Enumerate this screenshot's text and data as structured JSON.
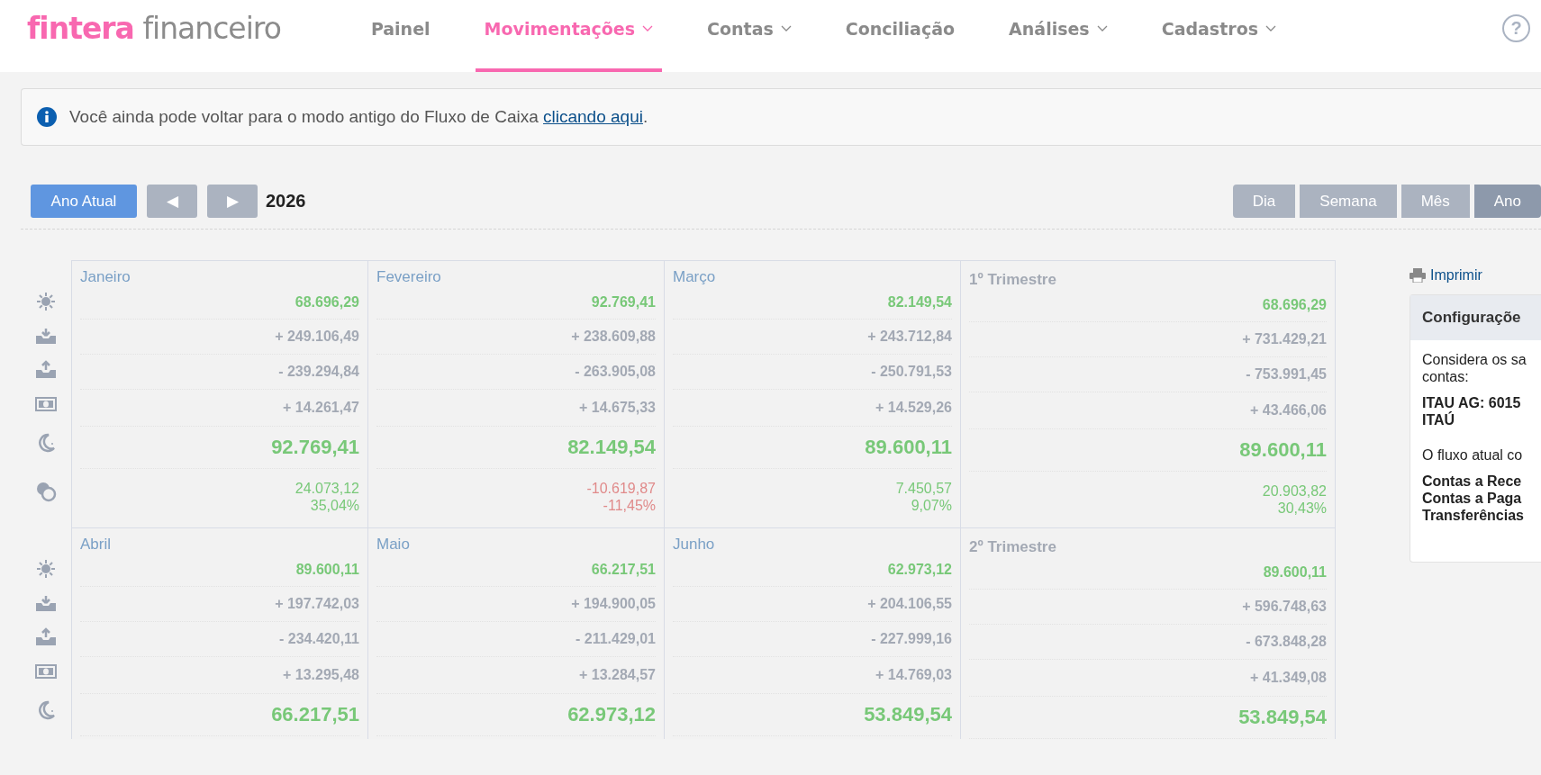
{
  "logo": {
    "brand": "fintera",
    "product": "financeiro"
  },
  "nav": [
    {
      "label": "Painel",
      "has_menu": false,
      "selected": false
    },
    {
      "label": "Movimentações",
      "has_menu": true,
      "selected": true
    },
    {
      "label": "Contas",
      "has_menu": true,
      "selected": false
    },
    {
      "label": "Conciliação",
      "has_menu": false,
      "selected": false
    },
    {
      "label": "Análises",
      "has_menu": true,
      "selected": false
    },
    {
      "label": "Cadastros",
      "has_menu": true,
      "selected": false
    }
  ],
  "help": "?",
  "notice": {
    "text": "Você ainda pode voltar para o modo antigo do Fluxo de Caixa ",
    "link": "clicando aqui",
    "end": "."
  },
  "toolbar": {
    "current_button": "Ano Atual",
    "prev": "◀",
    "next": "▶",
    "year": "2026",
    "views": [
      {
        "label": "Dia",
        "selected": false
      },
      {
        "label": "Semana",
        "selected": false
      },
      {
        "label": "Mês",
        "selected": false
      },
      {
        "label": "Ano",
        "selected": true
      }
    ]
  },
  "blocks": [
    {
      "periods": [
        {
          "kind": "month",
          "name": "Janeiro",
          "opening": "68.696,29",
          "inflows": "+ 249.106,49",
          "outflows": "- 239.294,84",
          "transfers": "+ 14.261,47",
          "closing": "92.769,41",
          "result": "24.073,12",
          "result_pct": "35,04%",
          "negative": false
        },
        {
          "kind": "month",
          "name": "Fevereiro",
          "opening": "92.769,41",
          "inflows": "+ 238.609,88",
          "outflows": "- 263.905,08",
          "transfers": "+ 14.675,33",
          "closing": "82.149,54",
          "result": "-10.619,87",
          "result_pct": "-11,45%",
          "negative": true
        },
        {
          "kind": "month",
          "name": "Março",
          "opening": "82.149,54",
          "inflows": "+ 243.712,84",
          "outflows": "- 250.791,53",
          "transfers": "+ 14.529,26",
          "closing": "89.600,11",
          "result": "7.450,57",
          "result_pct": "9,07%",
          "negative": false
        },
        {
          "kind": "quarter",
          "name": "1º Trimestre",
          "opening": "68.696,29",
          "inflows": "+ 731.429,21",
          "outflows": "- 753.991,45",
          "transfers": "+ 43.466,06",
          "closing": "89.600,11",
          "result": "20.903,82",
          "result_pct": "30,43%",
          "negative": false
        }
      ]
    },
    {
      "periods": [
        {
          "kind": "month",
          "name": "Abril",
          "opening": "89.600,11",
          "inflows": "+ 197.742,03",
          "outflows": "- 234.420,11",
          "transfers": "+ 13.295,48",
          "closing": "66.217,51"
        },
        {
          "kind": "month",
          "name": "Maio",
          "opening": "66.217,51",
          "inflows": "+ 194.900,05",
          "outflows": "- 211.429,01",
          "transfers": "+ 13.284,57",
          "closing": "62.973,12"
        },
        {
          "kind": "month",
          "name": "Junho",
          "opening": "62.973,12",
          "inflows": "+ 204.106,55",
          "outflows": "- 227.999,16",
          "transfers": "+ 14.769,03",
          "closing": "53.849,54"
        },
        {
          "kind": "quarter",
          "name": "2º Trimestre",
          "opening": "89.600,11",
          "inflows": "+ 596.748,63",
          "outflows": "- 673.848,28",
          "transfers": "+ 41.349,08",
          "closing": "53.849,54"
        }
      ]
    }
  ],
  "print_link": "Imprimir",
  "settings": {
    "title": "Configuraçõe",
    "accounts_intro": "Considera os sa contas:",
    "accounts": [
      "ITAU AG: 6015",
      "ITAÚ"
    ],
    "flow_intro": "O fluxo atual co",
    "flows": [
      "Contas a Rece",
      "Contas a Paga",
      "Transferências"
    ]
  }
}
